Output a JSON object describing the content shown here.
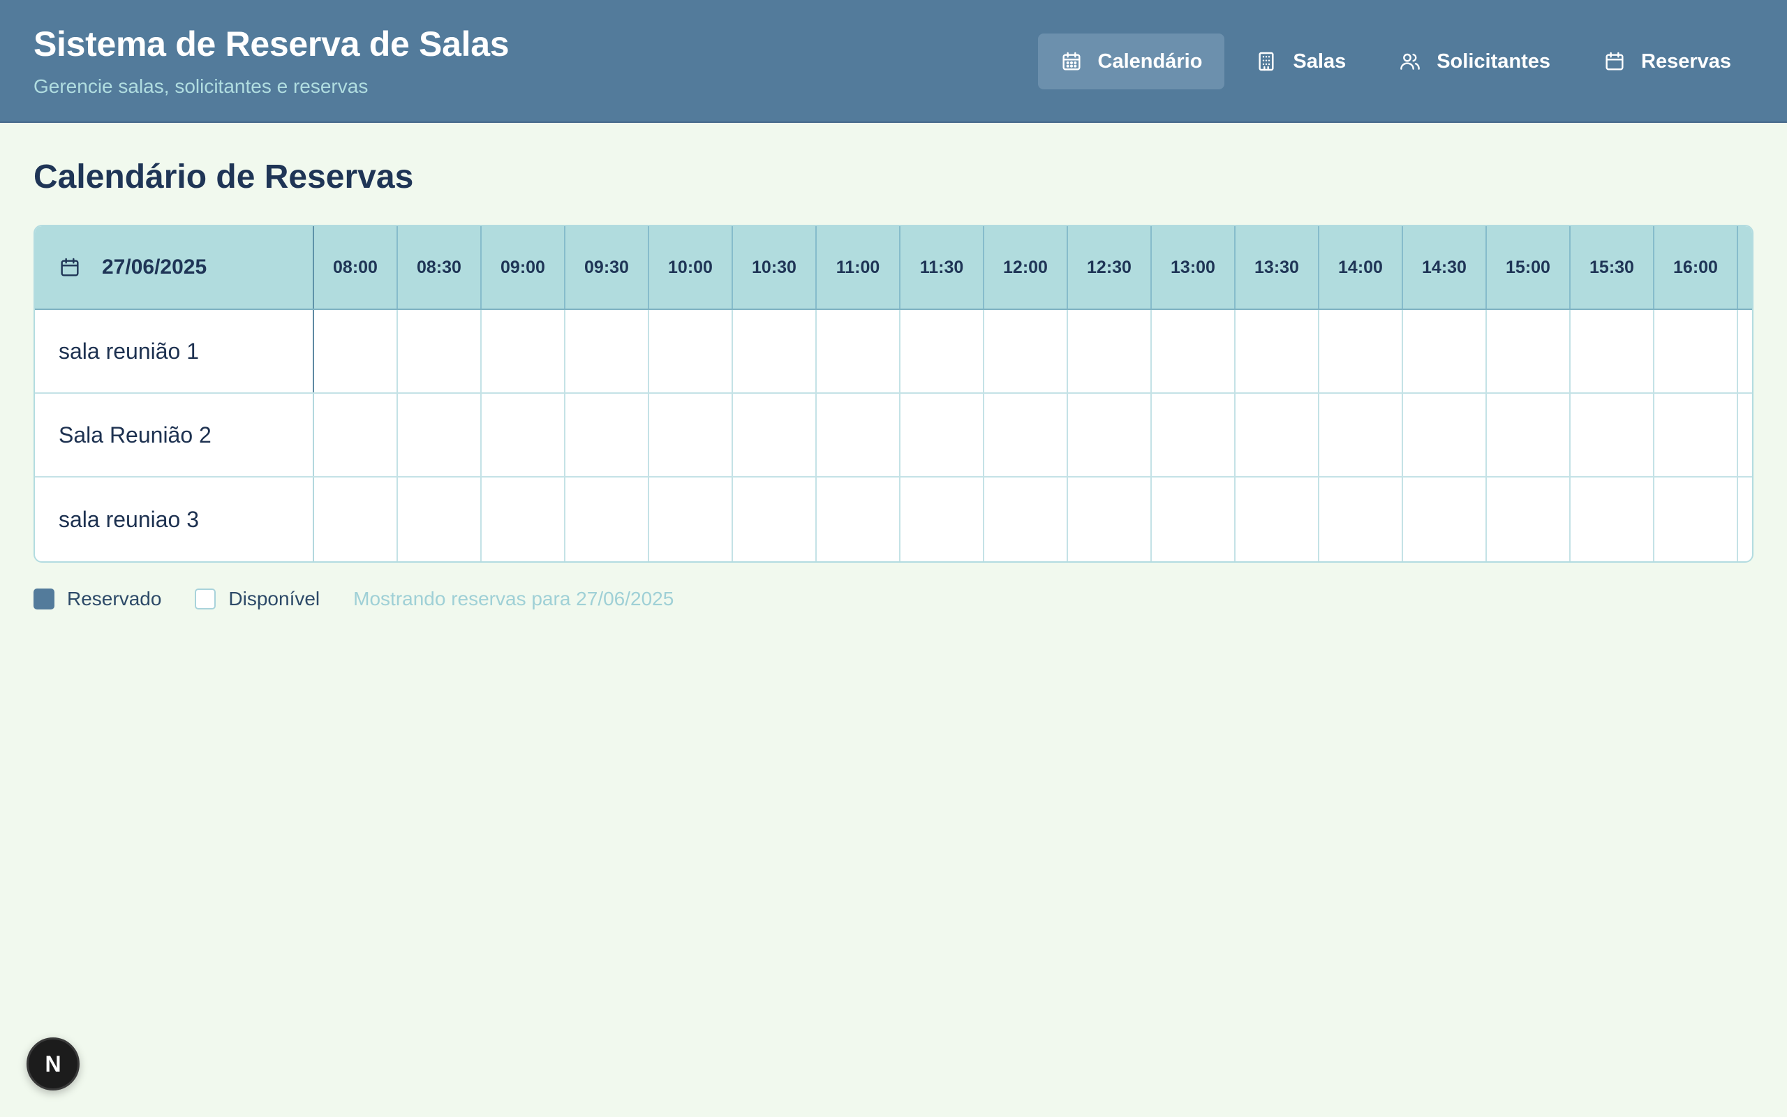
{
  "header": {
    "title": "Sistema de Reserva de Salas",
    "subtitle": "Gerencie salas, solicitantes e reservas"
  },
  "nav": {
    "items": [
      {
        "label": "Calendário",
        "icon": "calendar-icon",
        "active": true
      },
      {
        "label": "Salas",
        "icon": "building-icon",
        "active": false
      },
      {
        "label": "Solicitantes",
        "icon": "users-icon",
        "active": false
      },
      {
        "label": "Reservas",
        "icon": "calendar-icon",
        "active": false
      }
    ]
  },
  "main": {
    "title": "Calendário de Reservas"
  },
  "calendar": {
    "date": "27/06/2025",
    "times": [
      "08:00",
      "08:30",
      "09:00",
      "09:30",
      "10:00",
      "10:30",
      "11:00",
      "11:30",
      "12:00",
      "12:30",
      "13:00",
      "13:30",
      "14:00",
      "14:30",
      "15:00",
      "15:30",
      "16:00"
    ],
    "rooms": [
      {
        "name": "sala reunião 1"
      },
      {
        "name": "Sala Reunião 2"
      },
      {
        "name": "sala reuniao 3"
      }
    ]
  },
  "legend": {
    "booked_label": "Reservado",
    "free_label": "Disponível",
    "note": "Mostrando reservas para 27/06/2025"
  },
  "badge": {
    "label": "N"
  },
  "colors": {
    "header_bg": "#537b9b",
    "page_bg": "#f1f9ee",
    "table_head_bg": "#b1dcde",
    "booked": "#537b9b",
    "available": "#ffffff",
    "note_text": "#9fd0d6"
  }
}
